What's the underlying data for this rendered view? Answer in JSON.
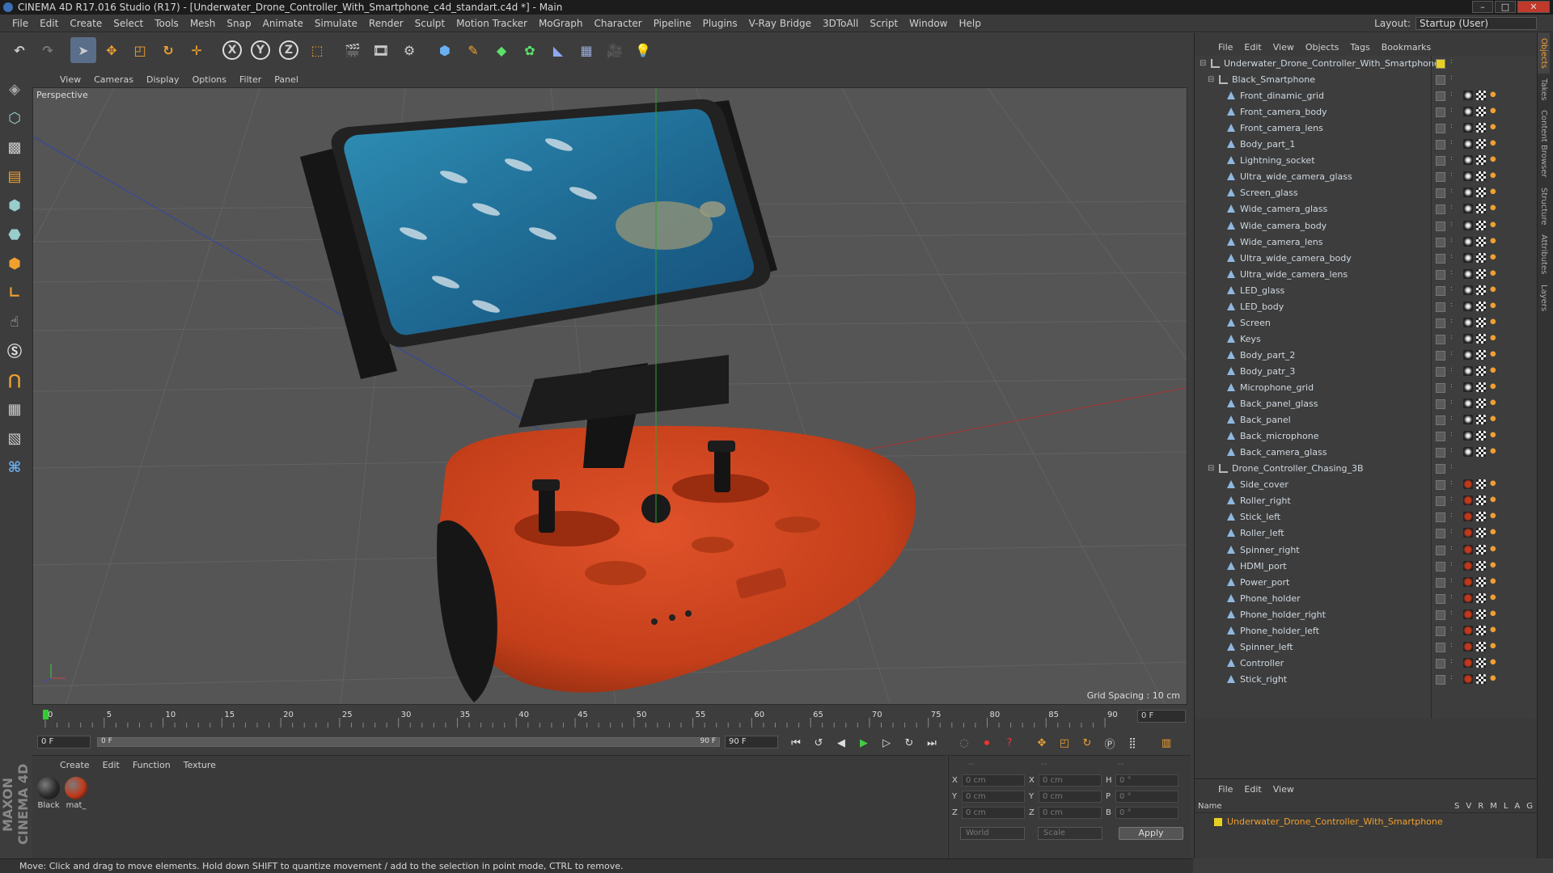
{
  "window": {
    "title": "CINEMA 4D R17.016 Studio (R17) - [Underwater_Drone_Controller_With_Smartphone_c4d_standart.c4d *] - Main"
  },
  "menubar": [
    "File",
    "Edit",
    "Create",
    "Select",
    "Tools",
    "Mesh",
    "Snap",
    "Animate",
    "Simulate",
    "Render",
    "Sculpt",
    "Motion Tracker",
    "MoGraph",
    "Character",
    "Pipeline",
    "Plugins",
    "V-Ray Bridge",
    "3DToAll",
    "Script",
    "Window",
    "Help"
  ],
  "layout": {
    "label": "Layout:",
    "value": "Startup (User)"
  },
  "toolbar": {
    "x": "X",
    "y": "Y",
    "z": "Z"
  },
  "viewport": {
    "menu": [
      "View",
      "Cameras",
      "Display",
      "Options",
      "Filter",
      "Panel"
    ],
    "label": "Perspective",
    "grid_spacing": "Grid Spacing : 10 cm"
  },
  "timeline": {
    "ticks": [
      "0",
      "5",
      "10",
      "15",
      "20",
      "25",
      "30",
      "35",
      "40",
      "45",
      "50",
      "55",
      "60",
      "65",
      "70",
      "75",
      "80",
      "85",
      "90"
    ],
    "current_frame": "0 F",
    "start": "0 F",
    "range_start": "0 F",
    "range_end": "90 F",
    "end": "90 F"
  },
  "materials": {
    "menu": [
      "Create",
      "Edit",
      "Function",
      "Texture"
    ],
    "items": [
      {
        "label": "Black",
        "color": "#2a2a2a"
      },
      {
        "label": "mat_",
        "color": "#c0391b"
      }
    ]
  },
  "coords": {
    "header": [
      "--",
      "--",
      "--"
    ],
    "rows": [
      {
        "a": "X",
        "av": "0 cm",
        "b": "X",
        "bv": "0 cm",
        "c": "H",
        "cv": "0 °"
      },
      {
        "a": "Y",
        "av": "0 cm",
        "b": "Y",
        "bv": "0 cm",
        "c": "P",
        "cv": "0 °"
      },
      {
        "a": "Z",
        "av": "0 cm",
        "b": "Z",
        "bv": "0 cm",
        "c": "B",
        "cv": "0 °"
      }
    ],
    "space": "World",
    "mode": "Scale",
    "apply": "Apply"
  },
  "status": "Move: Click and drag to move elements. Hold down SHIFT to quantize movement / add to the selection in point mode, CTRL to remove.",
  "objects": {
    "menu": [
      "File",
      "Edit",
      "View",
      "Objects",
      "Tags",
      "Bookmarks"
    ],
    "tree": [
      {
        "name": "Underwater_Drone_Controller_With_Smartphone",
        "level": 0,
        "type": "null"
      },
      {
        "name": "Black_Smartphone",
        "level": 1,
        "type": "null"
      },
      {
        "name": "Front_dinamic_grid",
        "level": 2,
        "type": "poly",
        "mat": "black"
      },
      {
        "name": "Front_camera_body",
        "level": 2,
        "type": "poly",
        "mat": "black"
      },
      {
        "name": "Front_camera_lens",
        "level": 2,
        "type": "poly",
        "mat": "black"
      },
      {
        "name": "Body_part_1",
        "level": 2,
        "type": "poly",
        "mat": "black"
      },
      {
        "name": "Lightning_socket",
        "level": 2,
        "type": "poly",
        "mat": "black"
      },
      {
        "name": "Ultra_wide_camera_glass",
        "level": 2,
        "type": "poly",
        "mat": "black"
      },
      {
        "name": "Screen_glass",
        "level": 2,
        "type": "poly",
        "mat": "black"
      },
      {
        "name": "Wide_camera_glass",
        "level": 2,
        "type": "poly",
        "mat": "black"
      },
      {
        "name": "Wide_camera_body",
        "level": 2,
        "type": "poly",
        "mat": "black"
      },
      {
        "name": "Wide_camera_lens",
        "level": 2,
        "type": "poly",
        "mat": "black"
      },
      {
        "name": "Ultra_wide_camera_body",
        "level": 2,
        "type": "poly",
        "mat": "black"
      },
      {
        "name": "Ultra_wide_camera_lens",
        "level": 2,
        "type": "poly",
        "mat": "black"
      },
      {
        "name": "LED_glass",
        "level": 2,
        "type": "poly",
        "mat": "black"
      },
      {
        "name": "LED_body",
        "level": 2,
        "type": "poly",
        "mat": "black"
      },
      {
        "name": "Screen",
        "level": 2,
        "type": "poly",
        "mat": "black"
      },
      {
        "name": "Keys",
        "level": 2,
        "type": "poly",
        "mat": "black"
      },
      {
        "name": "Body_part_2",
        "level": 2,
        "type": "poly",
        "mat": "black"
      },
      {
        "name": "Body_patr_3",
        "level": 2,
        "type": "poly",
        "mat": "black"
      },
      {
        "name": "Microphone_grid",
        "level": 2,
        "type": "poly",
        "mat": "black"
      },
      {
        "name": "Back_panel_glass",
        "level": 2,
        "type": "poly",
        "mat": "black"
      },
      {
        "name": "Back_panel",
        "level": 2,
        "type": "poly",
        "mat": "black"
      },
      {
        "name": "Back_microphone",
        "level": 2,
        "type": "poly",
        "mat": "black"
      },
      {
        "name": "Back_camera_glass",
        "level": 2,
        "type": "poly",
        "mat": "black"
      },
      {
        "name": "Drone_Controller_Chasing_3B",
        "level": 1,
        "type": "null"
      },
      {
        "name": "Side_cover",
        "level": 2,
        "type": "poly",
        "mat": "red"
      },
      {
        "name": "Roller_right",
        "level": 2,
        "type": "poly",
        "mat": "red"
      },
      {
        "name": "Stick_left",
        "level": 2,
        "type": "poly",
        "mat": "red"
      },
      {
        "name": "Roller_left",
        "level": 2,
        "type": "poly",
        "mat": "red"
      },
      {
        "name": "Spinner_right",
        "level": 2,
        "type": "poly",
        "mat": "red"
      },
      {
        "name": "HDMI_port",
        "level": 2,
        "type": "poly",
        "mat": "red"
      },
      {
        "name": "Power_port",
        "level": 2,
        "type": "poly",
        "mat": "red"
      },
      {
        "name": "Phone_holder",
        "level": 2,
        "type": "poly",
        "mat": "red"
      },
      {
        "name": "Phone_holder_right",
        "level": 2,
        "type": "poly",
        "mat": "red"
      },
      {
        "name": "Phone_holder_left",
        "level": 2,
        "type": "poly",
        "mat": "red"
      },
      {
        "name": "Spinner_left",
        "level": 2,
        "type": "poly",
        "mat": "red"
      },
      {
        "name": "Controller",
        "level": 2,
        "type": "poly",
        "mat": "red"
      },
      {
        "name": "Stick_right",
        "level": 2,
        "type": "poly",
        "mat": "red"
      }
    ]
  },
  "layers": {
    "menu": [
      "File",
      "Edit",
      "View"
    ],
    "name_header": "Name",
    "cols": [
      "S",
      "V",
      "R",
      "M",
      "L",
      "A",
      "G"
    ],
    "row": "Underwater_Drone_Controller_With_Smartphone",
    "row_color": "#e8d020"
  },
  "vtabs": [
    "Objects",
    "Takes",
    "Content Browser",
    "Structure",
    "Attributes",
    "Layers"
  ],
  "brand": "MAXON CINEMA 4D",
  "colors": {
    "accent": "#f0a030",
    "controller": "#d0441c",
    "bg": "#3d3d3d"
  }
}
